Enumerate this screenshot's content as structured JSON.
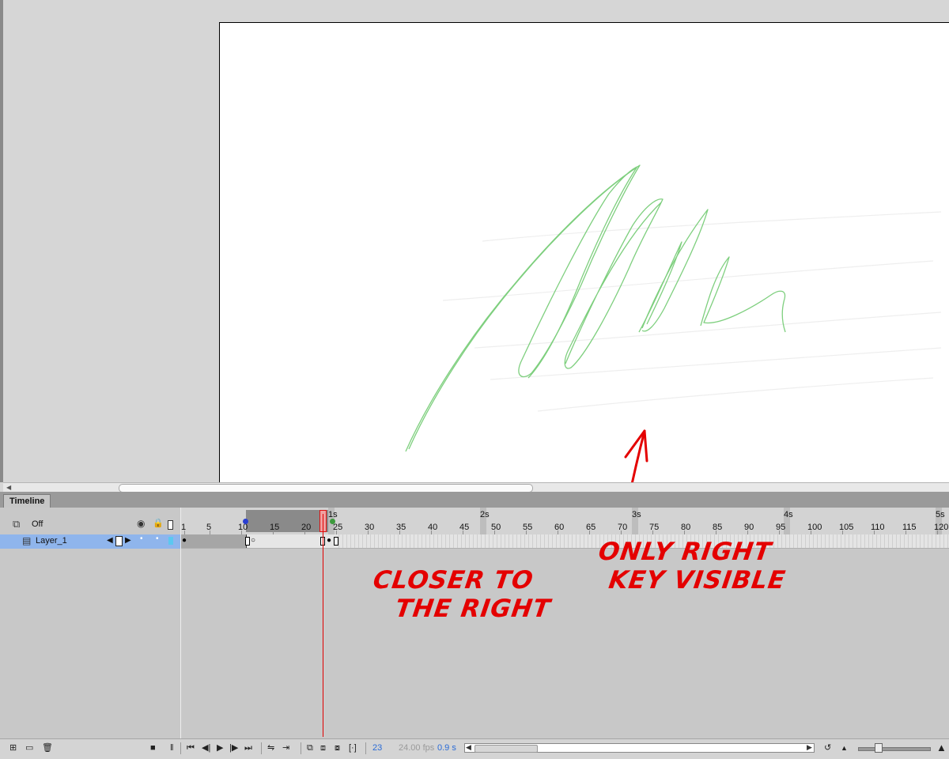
{
  "timeline_panel": {
    "tab_label": "Timeline",
    "header": {
      "onion_skin_label": "Off"
    },
    "layers": [
      {
        "name": "Layer_1"
      }
    ],
    "ruler": {
      "frame_numbers": [
        "1",
        "5",
        "10",
        "15",
        "20",
        "25",
        "30",
        "35",
        "40",
        "45",
        "50",
        "55",
        "60",
        "65",
        "70",
        "75",
        "80",
        "85",
        "90",
        "95",
        "100",
        "105",
        "110",
        "115",
        "120"
      ],
      "second_labels": [
        "1s",
        "2s",
        "3s",
        "4s",
        "5s"
      ]
    },
    "current_frame": 23,
    "selected_frame_index": 23,
    "fps": "24.00 fps",
    "elapsed_time": "0.9 s",
    "keyframes": [
      1,
      10,
      22,
      24
    ]
  },
  "annotations": {
    "left_note_line1": "CLOSER TO",
    "left_note_line2": "THE RIGHT",
    "right_note_line1": "ONLY RIGHT",
    "right_note_line2": "KEY VISIBLE",
    "color": "#e40000"
  },
  "colors": {
    "stroke_color": "#7ecf7e",
    "layer_highlight": "#8fb5ec",
    "playhead": "#e00000"
  }
}
